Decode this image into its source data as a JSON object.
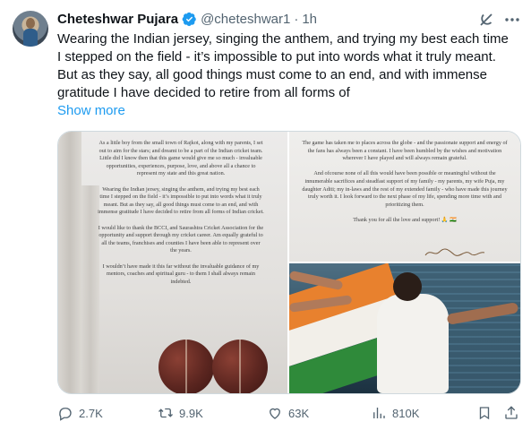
{
  "tweet": {
    "author_name": "Cheteshwar Pujara",
    "handle": "@cheteshwar1",
    "separator": "·",
    "time": "1h",
    "text": "Wearing the Indian jersey, singing the anthem, and trying my best each time\nI stepped on the field - it’s impossible to put into words what it truly meant.\nBut as they say, all good things must come to an end, and with immense\ngratitude I have decided to retire from all forms of",
    "show_more_label": "Show more"
  },
  "media": {
    "letter_page_1": "As a little boy from the small town of Rajkot, along with my parents, I set out to aim for the stars; and dreamt to be a part of the Indian cricket team. Little did I know then that this game would give me so much - invaluable opportunities, experiences, purpose, love, and above all a chance to represent my state and this great nation.\n\nWearing the Indian jersey, singing the anthem, and trying my best each time I stepped on the field - it’s impossible to put into words what it truly meant. But as they say, all good things must come to an end, and with immense gratitude I have decided to retire from all forms of Indian cricket.\n\nI would like to thank the BCCI, and Saurashtra Cricket Association for the opportunity and support through my cricket career. Am equally grateful to all the teams, franchises and counties I have been able to represent over the years.\n\nI wouldn’t have made it this far without the invaluable guidance of my mentors, coaches and spiritual guru - to them I shall always remain indebted.",
    "letter_page_2": "The game has taken me to places across the globe - and the passionate support and energy of the fans has always been a constant. I have been humbled by the wishes and motivation wherever I have played and will always remain grateful.\n\nAnd ofcourse none of all this would have been possible or meaningful without the innumerable sacrifices and steadfast support of my family - my parents, my wife Puja, my daughter Aditi; my in-laws and the rest of my extended family - who have made this journey truly worth it. I look forward to the next phase of my life, spending more time with and prioritizing them.\n\nThank you for all the love and support! 🙏 🇮🇳"
  },
  "actions": {
    "replies": "2.7K",
    "reposts": "9.9K",
    "likes": "63K",
    "views": "810K"
  },
  "colors": {
    "accent": "#1d9bf0",
    "muted": "#536471",
    "text": "#0f1419",
    "border": "#cfd9de"
  },
  "icons": [
    "verified-badge-icon",
    "grok-icon",
    "more-icon",
    "reply-icon",
    "repost-icon",
    "like-icon",
    "views-icon",
    "bookmark-icon",
    "share-icon"
  ]
}
